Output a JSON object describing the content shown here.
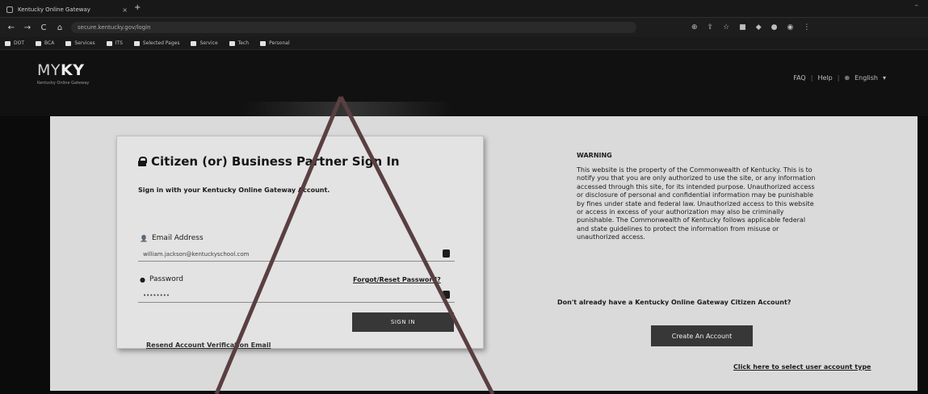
{
  "browser": {
    "tab_title": "Kentucky Online Gateway",
    "new_tab": "+",
    "window_min": "–",
    "nav": {
      "back": "←",
      "forward": "→",
      "reload": "C",
      "home": "⌂"
    },
    "url": "secure.kentucky.gov/login",
    "bookmarks": [
      "DOT",
      "BCA",
      "Services",
      "ITS",
      "Selected Pages",
      "Service",
      "Tech",
      "Personal"
    ]
  },
  "site": {
    "logo_prefix": "MY",
    "logo_main": "KY",
    "logo_sub": "Kentucky Online Gateway",
    "header_links": {
      "faq": "FAQ",
      "help": "Help",
      "language": "English"
    }
  },
  "signin": {
    "title": "Citizen (or) Business Partner Sign In",
    "subtitle": "Sign in with your Kentucky Online Gateway Account.",
    "email_label": "Email Address",
    "email_value": "william.jackson@kentuckyschool.com",
    "password_label": "Password",
    "password_value": "••••••••",
    "forgot_link": "Forgot/Reset Password?",
    "signin_button": "SIGN IN",
    "resend_link": "Resend Account Verification Email"
  },
  "warning": {
    "title": "WARNING",
    "text": "This website is the property of the Commonwealth of Kentucky. This is to notify you that you are only authorized to use the site, or any information accessed through this site, for its intended purpose. Unauthorized access or disclosure of personal and confidential information may be punishable by fines under state and federal law. Unauthorized access to this website or access in excess of your authorization may also be criminally punishable. The Commonwealth of Kentucky follows applicable federal and state guidelines to protect the information from misuse or unauthorized access."
  },
  "account": {
    "dont_have": "Don't already have a Kentucky Online Gateway Citizen Account?",
    "create_button": "Create An Account",
    "click_here": "Click here to select user account type"
  },
  "annotation": {
    "color": "#c8242f"
  }
}
